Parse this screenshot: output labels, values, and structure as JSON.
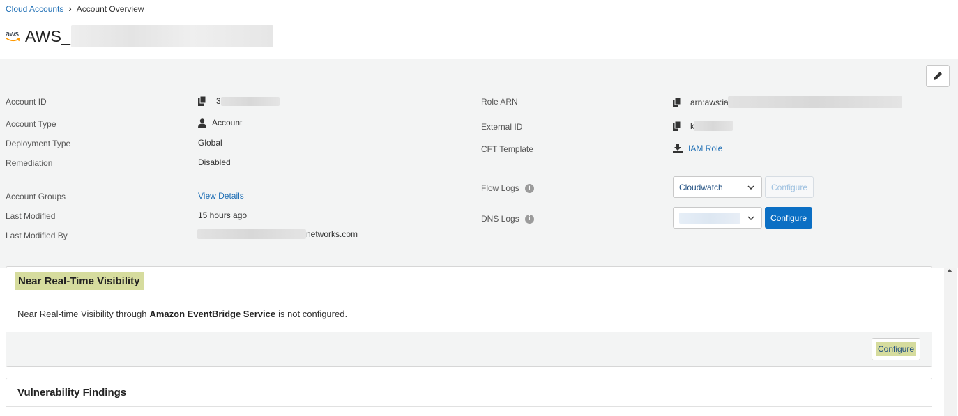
{
  "breadcrumb": {
    "parent": "Cloud Accounts",
    "current": "Account Overview"
  },
  "header": {
    "logo_text": "aws",
    "title_prefix": "AWS_"
  },
  "details_left": {
    "account_id": {
      "label": "Account ID",
      "value": "3"
    },
    "account_type": {
      "label": "Account Type",
      "value": "Account"
    },
    "deployment_type": {
      "label": "Deployment Type",
      "value": "Global"
    },
    "remediation": {
      "label": "Remediation",
      "value": "Disabled"
    },
    "account_groups": {
      "label": "Account Groups",
      "value": "View Details"
    },
    "last_modified": {
      "label": "Last Modified",
      "value": "15 hours ago"
    },
    "last_modified_by": {
      "label": "Last Modified By",
      "value": "networks.com"
    }
  },
  "details_right": {
    "role_arn": {
      "label": "Role ARN",
      "value": "arn:aws:ia"
    },
    "external_id": {
      "label": "External ID",
      "value": "k"
    },
    "cft_template": {
      "label": "CFT Template",
      "value": "IAM Role"
    },
    "flow_logs": {
      "label": "Flow Logs",
      "selected": "Cloudwatch",
      "button": "Configure"
    },
    "dns_logs": {
      "label": "DNS Logs",
      "selected": "",
      "button": "Configure"
    }
  },
  "panels": {
    "nrtv": {
      "title": "Near Real-Time Visibility",
      "text_before": "Near Real-time Visibility through",
      "service": "Amazon EventBridge Service",
      "text_after": "is not configured.",
      "button": "Configure"
    },
    "vuln": {
      "title": "Vulnerability Findings"
    }
  },
  "icons": {
    "edit": "pencil-icon",
    "copy": "copy-icon",
    "user": "user-icon",
    "download": "download-icon",
    "info": "info-icon",
    "chevron": "chevron-down-icon"
  },
  "colors": {
    "link": "#1f6fb5",
    "primary_button": "#0b6fc4",
    "highlight": "#d6dc9e",
    "details_background": "#f3f4f4"
  }
}
